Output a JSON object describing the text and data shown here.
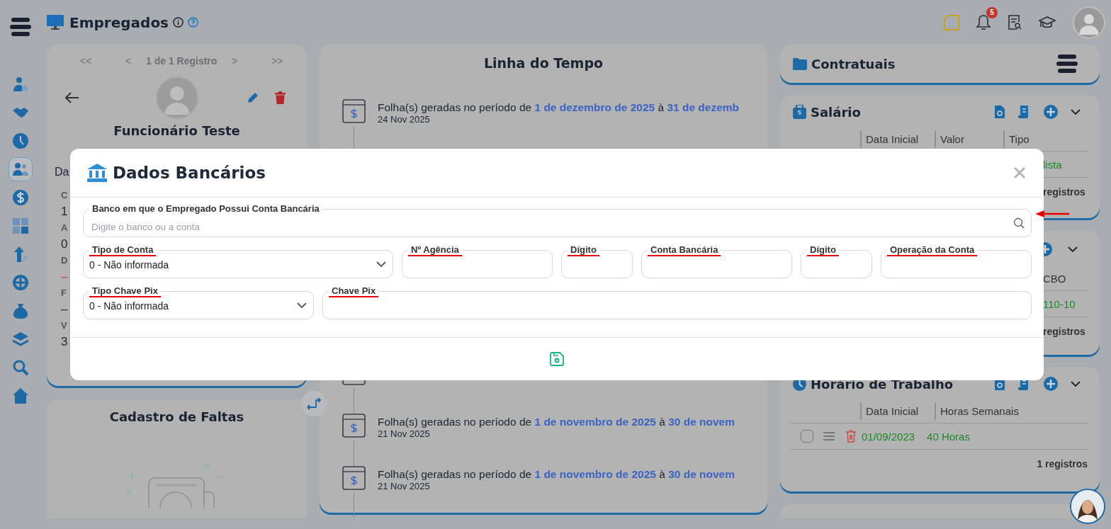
{
  "app": {
    "title": "Empregados"
  },
  "sidebar": {
    "items": [
      {
        "selected": false
      },
      {
        "selected": false
      },
      {
        "selected": false
      },
      {
        "selected": true
      },
      {
        "selected": false
      },
      {
        "selected": false
      },
      {
        "selected": false
      },
      {
        "selected": false
      },
      {
        "selected": false
      },
      {
        "selected": false
      },
      {
        "selected": false
      },
      {
        "selected": false
      }
    ]
  },
  "topbar": {
    "notifications_badge": "5"
  },
  "employee_card": {
    "pager": [
      "<<",
      "<",
      "1 de 1 Registro",
      ">",
      ">>"
    ],
    "name": "Funcionário Teste",
    "section_label": "Da",
    "details": [
      {
        "kind": "label",
        "text": "C"
      },
      {
        "kind": "value",
        "text": "1"
      },
      {
        "kind": "label",
        "text": "A"
      },
      {
        "kind": "value",
        "text": "0"
      },
      {
        "kind": "label",
        "text": "D"
      },
      {
        "kind": "alert",
        "text": "–"
      },
      {
        "kind": "label",
        "text": "F"
      },
      {
        "kind": "value",
        "text": "–"
      },
      {
        "kind": "label",
        "text": "V"
      },
      {
        "kind": "value",
        "text": "3"
      }
    ]
  },
  "absences_card": {
    "title": "Cadastro de Faltas"
  },
  "timeline": {
    "title": "Linha do Tempo",
    "items": [
      {
        "text": "Folha(s) geradas no período de **1 de dezembro de 2025** à **31 de dezemb**",
        "date": "24 Nov 2025"
      },
      {
        "text": "Folha(s) geradas no período de **1 de novembro de 2025** à **30 de novem**",
        "date": "21 Nov 2025"
      },
      {
        "text": "Folha(s) geradas no período de **1 de novembro de 2025** à **30 de novem**",
        "date": "21 Nov 2025"
      }
    ]
  },
  "contract_panel": {
    "title": "Contratuais"
  },
  "salary": {
    "title": "Salário",
    "columns": [
      "Data Inicial",
      "Valor",
      "Tipo"
    ],
    "row_fragment": "lista",
    "footer_fragment": "registros"
  },
  "occupation": {
    "column_fragment": "CBO",
    "row_fragment": "110-10",
    "footer_fragment": "registros"
  },
  "schedule": {
    "title": "Horário de Trabalho",
    "columns": [
      "Data Inicial",
      "Horas Semanais"
    ],
    "rows": [
      {
        "checked": false,
        "cells": [
          "01/09/2023",
          "40 Horas"
        ]
      }
    ],
    "footer": "1 registros"
  },
  "modal": {
    "title": "Dados Bancários",
    "rows": [
      [
        {
          "kind": "search",
          "label": "Banco em que o Empregado Possui Conta Bancária",
          "placeholder": "Digite o banco ou a conta",
          "underlined": false,
          "arrow": true
        }
      ],
      [
        {
          "kind": "select",
          "label": "Tipo de Conta",
          "value": "0 - Não informada",
          "underlined": true
        },
        {
          "kind": "input",
          "label": "Nº Agência",
          "underlined": true
        },
        {
          "kind": "input",
          "label": "Dígito",
          "underlined": true
        },
        {
          "kind": "input",
          "label": "Conta Bancária",
          "underlined": true
        },
        {
          "kind": "input",
          "label": "Dígito",
          "underlined": true
        },
        {
          "kind": "input",
          "label": "Operação da Conta",
          "underlined": true
        }
      ],
      [
        {
          "kind": "select",
          "label": "Tipo Chave Pix",
          "value": "0 - Não informada",
          "underlined": true
        },
        {
          "kind": "input",
          "label": "Chave Pix",
          "underlined": true
        }
      ]
    ]
  }
}
